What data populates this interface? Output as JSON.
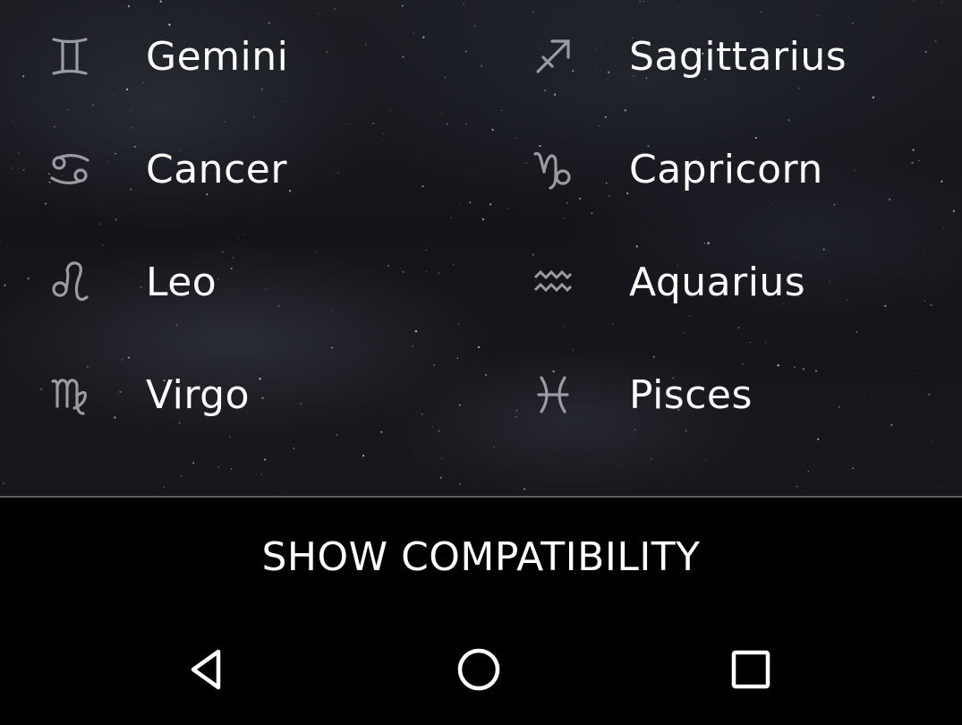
{
  "signs": {
    "left": [
      {
        "name": "Gemini",
        "icon": "gemini-icon",
        "glyph": "gemini"
      },
      {
        "name": "Cancer",
        "icon": "cancer-icon",
        "glyph": "cancer"
      },
      {
        "name": "Leo",
        "icon": "leo-icon",
        "glyph": "leo"
      },
      {
        "name": "Virgo",
        "icon": "virgo-icon",
        "glyph": "virgo"
      }
    ],
    "right": [
      {
        "name": "Sagittarius",
        "icon": "sagittarius-icon",
        "glyph": "sagittarius"
      },
      {
        "name": "Capricorn",
        "icon": "capricorn-icon",
        "glyph": "capricorn"
      },
      {
        "name": "Aquarius",
        "icon": "aquarius-icon",
        "glyph": "aquarius"
      },
      {
        "name": "Pisces",
        "icon": "pisces-icon",
        "glyph": "pisces"
      }
    ]
  },
  "action": {
    "label": "SHOW COMPATIBILITY"
  },
  "nav": {
    "back_icon": "back-triangle-icon",
    "home_icon": "home-circle-icon",
    "recents_icon": "recents-square-icon"
  },
  "colors": {
    "text": "#ffffff",
    "glyph": "#9a9ca2",
    "divider": "#5a5c62",
    "bar_background": "#000000"
  }
}
